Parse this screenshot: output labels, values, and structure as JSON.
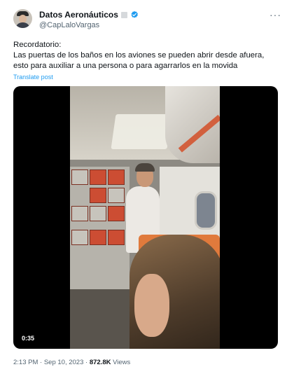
{
  "author": {
    "display_name": "Datos Aeronáuticos",
    "handle": "@CapLaloVargas",
    "verified": true,
    "avatar_icon": "pilot-avatar"
  },
  "tweet": {
    "text_line1": "Recordatorio:",
    "text_line2": "Las puertas de los baños en los aviones se pueden abrir desde afuera,",
    "text_line3": "esto para auxiliar a una persona o para agarrarlos en la movida",
    "translate_label": "Translate post",
    "more_label": "···"
  },
  "media": {
    "type": "video",
    "duration": "0:35"
  },
  "meta": {
    "time": "2:13 PM",
    "separator": "·",
    "date": "Sep 10, 2023",
    "views_count": "872.8K",
    "views_label": "Views"
  },
  "colors": {
    "link": "#1d9bf0",
    "secondary_text": "#536471",
    "primary_text": "#0f1419"
  }
}
